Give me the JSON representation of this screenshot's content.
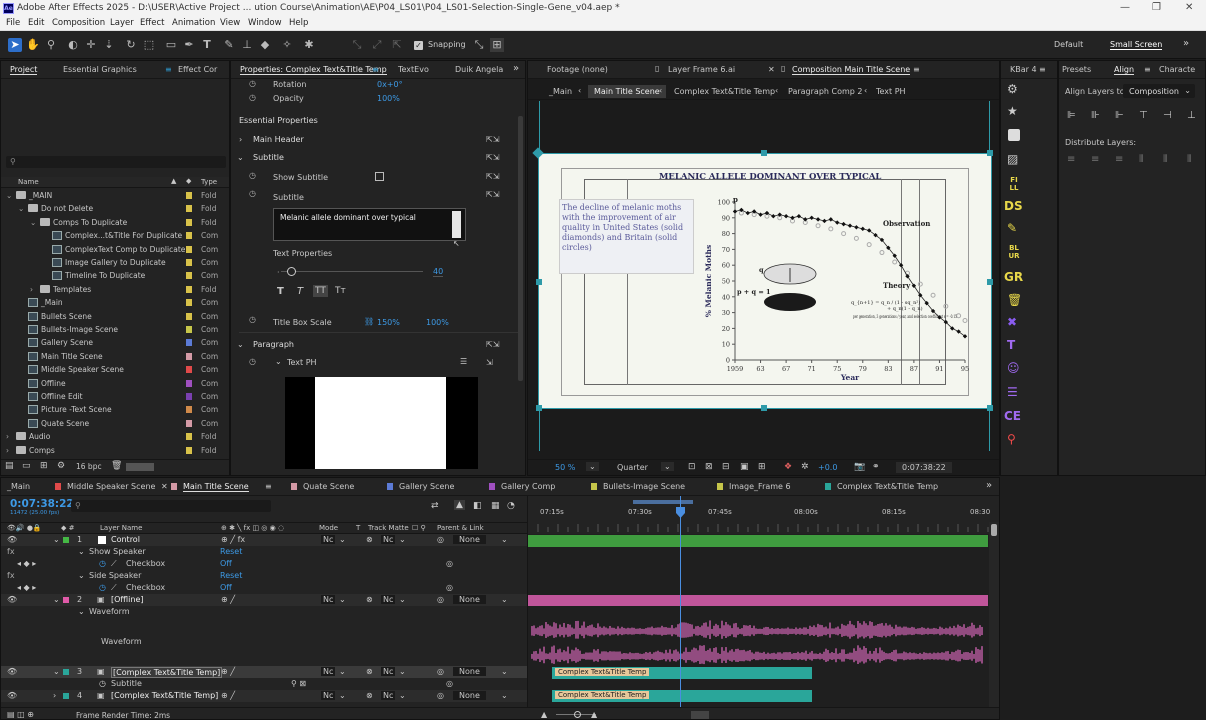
{
  "app": {
    "title": "Adobe After Effects 2025 - D:\\USER\\Active Project ... ution Course\\Animation\\AE\\P04_LS01\\P04_LS01-Selection-Single-Gene_v04.aep *",
    "logo": "Ae"
  },
  "menu": [
    "File",
    "Edit",
    "Composition",
    "Layer",
    "Effect",
    "Animation",
    "View",
    "Window",
    "Help"
  ],
  "toolbar": {
    "snapping": "Snapping",
    "workspace_default": "Default",
    "workspace_active": "Small Screen"
  },
  "project": {
    "tabs": [
      "Project",
      "Essential Graphics",
      "Effect Cor"
    ],
    "col_name": "Name",
    "col_type": "Type",
    "rows": [
      {
        "name": "_MAIN",
        "type": "Fold",
        "kind": "folder",
        "indent": 0,
        "color": "#d8c24a"
      },
      {
        "name": "Do not Delete",
        "type": "Fold",
        "kind": "folder",
        "indent": 1,
        "color": "#d8c24a"
      },
      {
        "name": "Comps To Duplicate",
        "type": "Fold",
        "kind": "folder",
        "indent": 2,
        "color": "#d8c24a"
      },
      {
        "name": "Complex...t&Title For Duplicate",
        "type": "Com",
        "kind": "comp",
        "indent": 3,
        "color": "#d8c24a"
      },
      {
        "name": "ComplexText Comp to Duplicate",
        "type": "Com",
        "kind": "comp",
        "indent": 3,
        "color": "#d8c24a"
      },
      {
        "name": "Image Gallery to Duplicate",
        "type": "Com",
        "kind": "comp",
        "indent": 3,
        "color": "#d8c24a"
      },
      {
        "name": "Timeline To Duplicate",
        "type": "Com",
        "kind": "comp",
        "indent": 3,
        "color": "#d8c24a"
      },
      {
        "name": "Templates",
        "type": "Fold",
        "kind": "folder",
        "indent": 2,
        "color": "#d8c24a"
      },
      {
        "name": "_Main",
        "type": "Com",
        "kind": "comp",
        "indent": 1,
        "color": "#d8c24a"
      },
      {
        "name": "Bullets Scene",
        "type": "Com",
        "kind": "comp",
        "indent": 1,
        "color": "#d8c24a"
      },
      {
        "name": "Bullets-Image Scene",
        "type": "Com",
        "kind": "comp",
        "indent": 1,
        "color": "#c6c64a"
      },
      {
        "name": "Gallery Scene",
        "type": "Com",
        "kind": "comp",
        "indent": 1,
        "color": "#5c7bd6"
      },
      {
        "name": "Main Title Scene",
        "type": "Com",
        "kind": "comp",
        "indent": 1,
        "color": "#d49aa6"
      },
      {
        "name": "Middle Speaker Scene",
        "type": "Com",
        "kind": "comp",
        "indent": 1,
        "color": "#e04a4a"
      },
      {
        "name": "Offline",
        "type": "Com",
        "kind": "comp",
        "indent": 1,
        "color": "#a050c0"
      },
      {
        "name": "Offline Edit",
        "type": "Com",
        "kind": "comp",
        "indent": 1,
        "color": "#7a40b0"
      },
      {
        "name": "Picture -Text Scene",
        "type": "Com",
        "kind": "comp",
        "indent": 1,
        "color": "#d08a4a"
      },
      {
        "name": "Quate Scene",
        "type": "Com",
        "kind": "comp",
        "indent": 1,
        "color": "#d49aa6"
      },
      {
        "name": "Audio",
        "type": "Fold",
        "kind": "folder",
        "indent": 0,
        "color": "#d8c24a"
      },
      {
        "name": "Comps",
        "type": "Fold",
        "kind": "folder",
        "indent": 0,
        "color": "#d8c24a"
      }
    ],
    "bpc": "16 bpc"
  },
  "properties": {
    "tabs": [
      "Properties: Complex Text&Title Temp",
      "TextEvo",
      "Duik Angela"
    ],
    "rotation_label": "Rotation",
    "rotation_value": "0x+0°",
    "opacity_label": "Opacity",
    "opacity_value": "100%",
    "essential": "Essential Properties",
    "main_header": "Main Header",
    "subtitle_group": "Subtitle",
    "show_subtitle": "Show Subtitle",
    "subtitle_label": "Subtitle",
    "subtitle_text": "Melanic allele dominant over typical",
    "text_properties": "Text Properties",
    "slider_value": "40",
    "title_box_scale": "Title Box Scale",
    "scale_x": "150%",
    "scale_y": "100%",
    "paragraph": "Paragraph",
    "text_ph": "Text PH",
    "format_buttons": [
      "T",
      "T",
      "TT",
      "Tт"
    ]
  },
  "viewer": {
    "tabs": [
      "Footage (none)",
      "Layer Frame 6.ai",
      "Composition Main Title Scene"
    ],
    "breadcrumbs": [
      "_Main",
      "Main Title Scene",
      "Complex Text&Title Temp",
      "Paragraph Comp 2",
      "Text PH"
    ],
    "zoom": "50 %",
    "resolution": "Quarter",
    "exposure": "+0.0",
    "timecode": "0:07:38:22"
  },
  "slide": {
    "heading": "MELANIC ALLELE DOMINANT OVER TYPICAL",
    "body": "The decline of melanic moths with the improvement of air quality in United States (solid diamonds) and Britain (solid circles)",
    "ylabel": "% Melanic Moths",
    "xlabel": "Year",
    "observation": "Observation",
    "theory": "Theory",
    "p_label": "p",
    "q_label": "q",
    "pq": "p + q = 1",
    "note": "per generation, 3 generations / year, and selection coefficient s = -0.15",
    "formula1": "q_{n+1} = q_n / (1 - sq_n²)",
    "formula2": "+ q_n(1 - q_n)"
  },
  "chart_data": {
    "type": "scatter",
    "xlabel": "Year",
    "ylabel": "% Melanic Moths",
    "ylim": [
      0,
      100
    ],
    "x_ticks": [
      "1959",
      "63",
      "67",
      "71",
      "75",
      "79",
      "83",
      "87",
      "91",
      "95"
    ],
    "y_ticks": [
      "0",
      "10",
      "20",
      "30",
      "40",
      "50",
      "60",
      "70",
      "80",
      "90",
      "100"
    ],
    "series": [
      {
        "values": [
          [
            1959,
            94
          ],
          [
            1960,
            95
          ],
          [
            1961,
            93
          ],
          [
            1962,
            94
          ],
          [
            1963,
            92
          ],
          [
            1964,
            93
          ],
          [
            1965,
            91
          ],
          [
            1966,
            92
          ],
          [
            1967,
            91
          ],
          [
            1968,
            90
          ],
          [
            1969,
            91
          ],
          [
            1970,
            89
          ],
          [
            1971,
            90
          ],
          [
            1972,
            89
          ],
          [
            1973,
            88
          ],
          [
            1974,
            89
          ],
          [
            1975,
            87
          ],
          [
            1976,
            86
          ],
          [
            1977,
            85
          ],
          [
            1978,
            84
          ],
          [
            1979,
            83
          ],
          [
            1980,
            82
          ],
          [
            1981,
            79
          ],
          [
            1982,
            76
          ],
          [
            1983,
            71
          ],
          [
            1984,
            66
          ],
          [
            1985,
            60
          ],
          [
            1986,
            53
          ],
          [
            1987,
            47
          ],
          [
            1988,
            41
          ],
          [
            1989,
            36
          ],
          [
            1990,
            31
          ],
          [
            1991,
            27
          ],
          [
            1992,
            24
          ],
          [
            1993,
            20
          ],
          [
            1994,
            18
          ],
          [
            1995,
            15
          ]
        ]
      },
      {
        "values": [
          [
            1960,
            93
          ],
          [
            1962,
            92
          ],
          [
            1964,
            91
          ],
          [
            1966,
            90
          ],
          [
            1968,
            88
          ],
          [
            1970,
            87
          ],
          [
            1972,
            85
          ],
          [
            1974,
            83
          ],
          [
            1976,
            80
          ],
          [
            1978,
            77
          ],
          [
            1980,
            73
          ],
          [
            1982,
            68
          ],
          [
            1984,
            62
          ],
          [
            1986,
            55
          ],
          [
            1988,
            48
          ],
          [
            1990,
            41
          ],
          [
            1992,
            34
          ],
          [
            1994,
            28
          ],
          [
            1995,
            25
          ]
        ]
      }
    ]
  },
  "right": {
    "tabs": [
      "KBar 4",
      "Presets",
      "Align",
      "Characte"
    ],
    "align_to_label": "Align Layers to:",
    "align_to_value": "Composition",
    "distribute": "Distribute Layers:",
    "dock": [
      "FI LL",
      "DS",
      "BL UR",
      "GR",
      "CE"
    ]
  },
  "timeline": {
    "tabs": [
      "_Main",
      "Middle Speaker Scene",
      "Main Title Scene",
      "Quate Scene",
      "Gallery Scene",
      "Gallery Comp",
      "Bullets-Image Scene",
      "Image_Frame 6",
      "Complex Text&Title Temp"
    ],
    "tab_colors": [
      "#d8c24a",
      "#e04a4a",
      "#d49aa6",
      "#d49aa6",
      "#5c7bd6",
      "#a050c0",
      "#c6c64a",
      "#c6c64a",
      "#2aa69a"
    ],
    "timecode": "0:07:38:22",
    "frames": "11472 (25.00 fps)",
    "cols": {
      "layer_name": "Layer Name",
      "mode": "Mode",
      "t": "T",
      "track_matte": "Track Matte",
      "parent": "Parent & Link"
    },
    "ruler": [
      "07:15s",
      "07:30s",
      "07:45s",
      "08:00s",
      "08:15s",
      "08:30"
    ],
    "layers": [
      {
        "num": "1",
        "name": "Control",
        "mode": "Nc",
        "matte": "Nc",
        "parent": "None"
      },
      {
        "num": "2",
        "name": "[Offline]",
        "mode": "Nc",
        "matte": "Nc",
        "parent": "None"
      },
      {
        "num": "3",
        "name": "[Complex Text&Title Temp]",
        "mode": "Nc",
        "matte": "Nc",
        "parent": "None"
      },
      {
        "num": "4",
        "name": "[Complex Text&Title Temp]",
        "mode": "Nc",
        "matte": "Nc",
        "parent": "None"
      }
    ],
    "sub": {
      "show_speaker": "Show Speaker",
      "side_speaker": "Side Speaker",
      "checkbox": "Checkbox",
      "reset": "Reset",
      "off": "Off",
      "waveform": "Waveform",
      "subtitle": "Subtitle"
    },
    "bar_label": "Complex Text&Title Temp",
    "render_time": "Frame Render Time: 2ms"
  }
}
